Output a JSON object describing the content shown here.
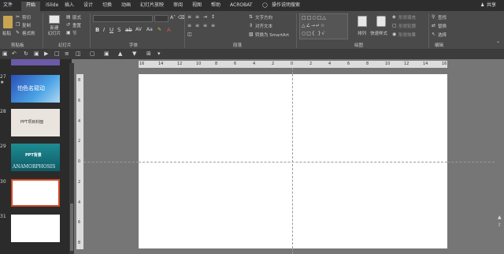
{
  "tabs": [
    "文件",
    "开始",
    "iSlide",
    "插入",
    "设计",
    "切换",
    "动画",
    "幻灯片放映",
    "审阅",
    "视图",
    "帮助",
    "ACROBAT",
    "操作说明搜索"
  ],
  "share": "共享",
  "ribbon": {
    "clipboard": {
      "paste": "粘贴",
      "cut": "剪切",
      "copy": "复制",
      "format_painter": "格式刷",
      "label": "剪贴板"
    },
    "slides": {
      "new_slide": "新建\n幻灯片",
      "layout": "版式",
      "reset": "重置",
      "section": "节",
      "label": "幻灯片"
    },
    "font": {
      "label": "字体"
    },
    "paragraph": {
      "text_direction": "文字方向",
      "align_text": "对齐文本",
      "smartart": "转换为 SmartArt",
      "label": "段落"
    },
    "drawing": {
      "arrange": "排列",
      "quick_styles": "快速样式",
      "shape_fill": "形状填充",
      "shape_outline": "形状轮廓",
      "shape_effects": "形状效果",
      "label": "绘图"
    },
    "editing": {
      "find": "查找",
      "replace": "替换",
      "select": "选择",
      "label": "编辑"
    }
  },
  "slides": [
    {
      "num": "27",
      "mark": "★",
      "text": "怕色名窥动"
    },
    {
      "num": "28",
      "text": "PPT项目封面"
    },
    {
      "num": "29",
      "text": "PPT背景",
      "subtext": "ANAMORPHOSIS"
    },
    {
      "num": "30",
      "text": ""
    },
    {
      "num": "31",
      "text": ""
    }
  ],
  "ruler_h": [
    "16",
    "14",
    "12",
    "10",
    "8",
    "6",
    "4",
    "2",
    "0",
    "2",
    "4",
    "6",
    "8",
    "10",
    "12",
    "14",
    "16"
  ],
  "ruler_v": [
    "8",
    "6",
    "4",
    "2",
    "0",
    "2",
    "4",
    "6",
    "8"
  ]
}
